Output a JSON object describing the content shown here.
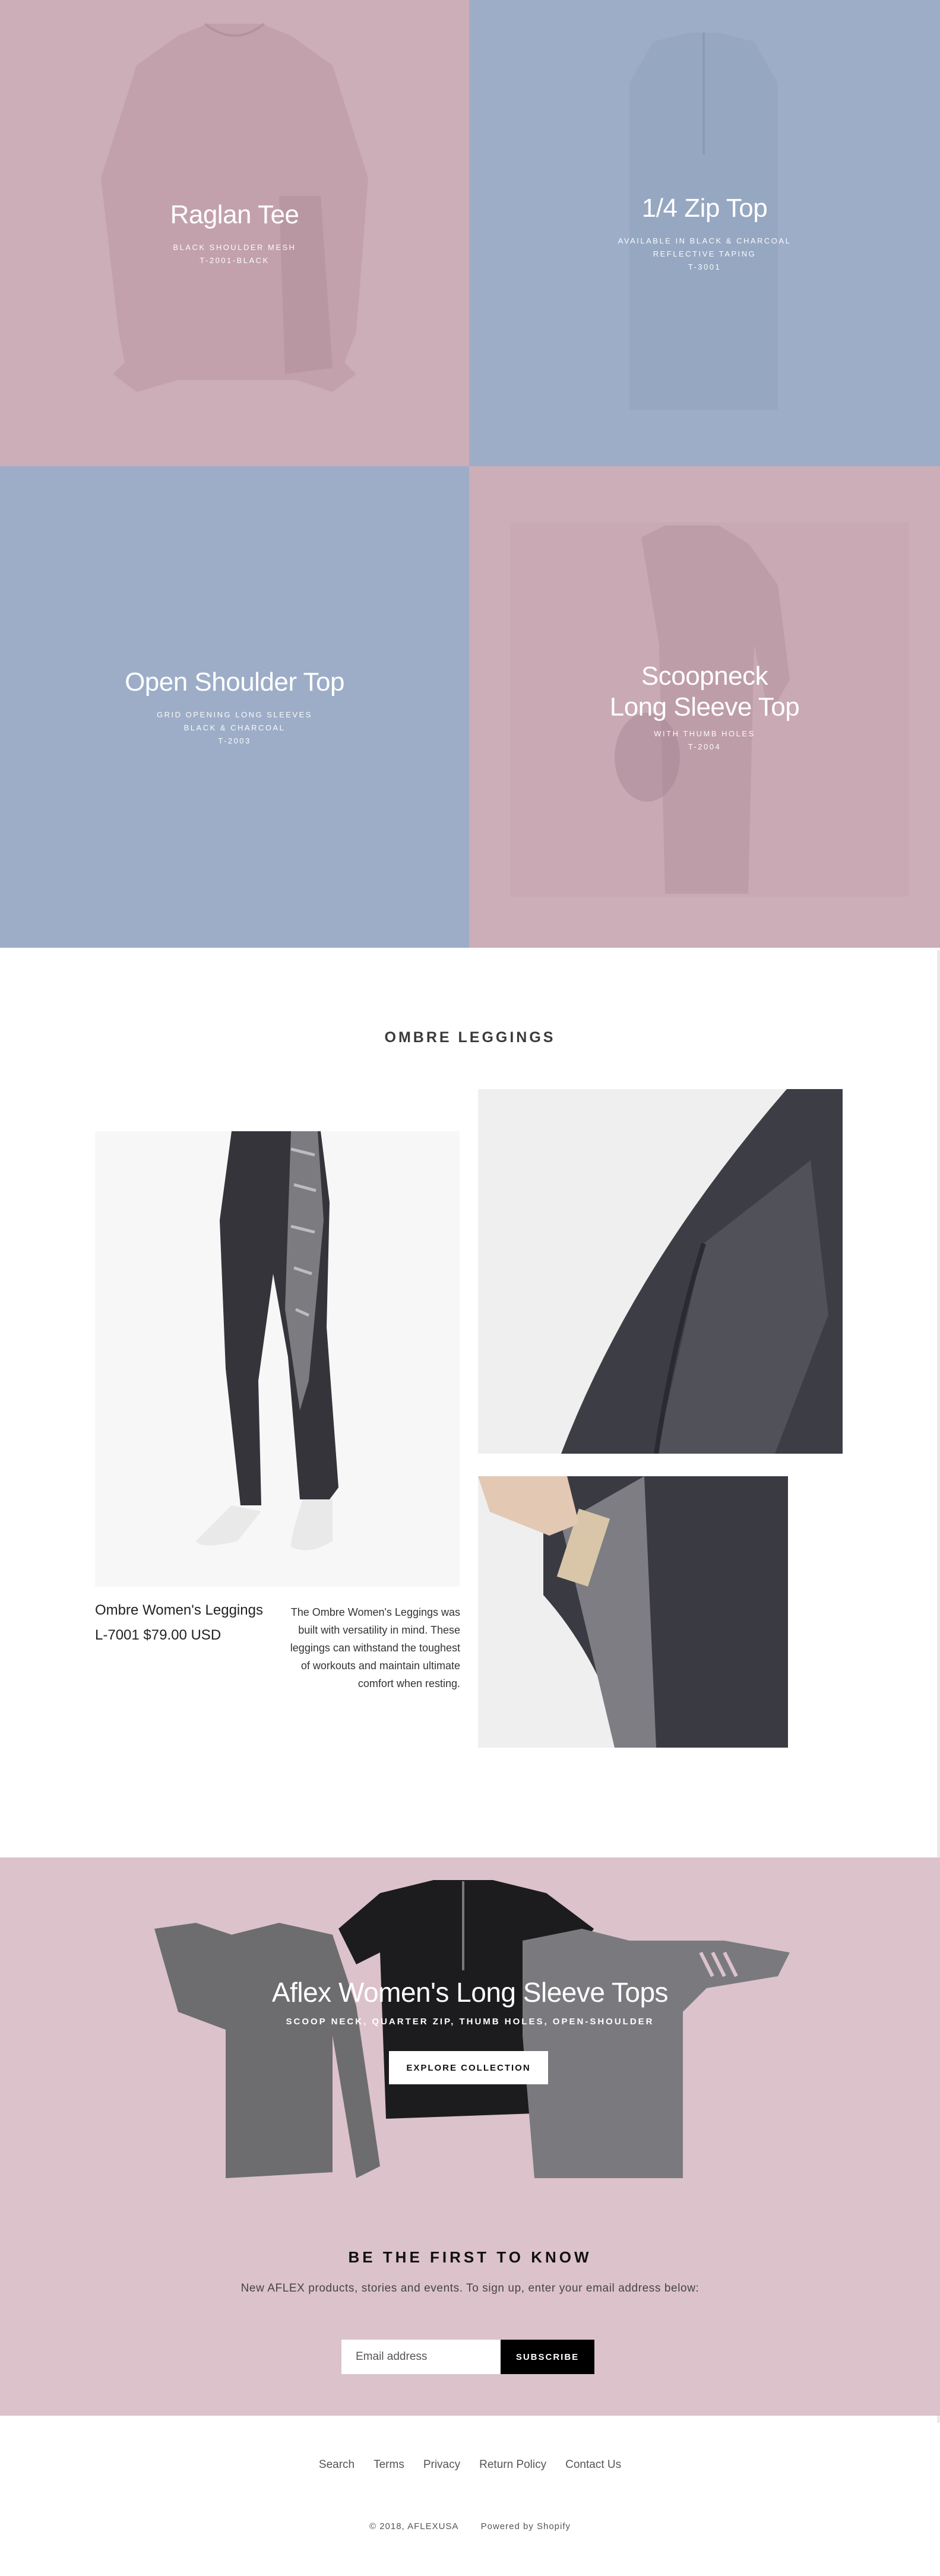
{
  "tiles": [
    {
      "title": "Raglan Tee",
      "lines": [
        "BLACK SHOULDER MESH",
        "T-2001-BLACK"
      ],
      "bg": "#cbaeb8"
    },
    {
      "title": "1/4 Zip Top",
      "lines": [
        "AVAILABLE IN BLACK & CHARCOAL",
        "REFLECTIVE TAPING",
        "T-3001"
      ],
      "bg": "#9dadc7"
    },
    {
      "title": "Open Shoulder Top",
      "lines": [
        "GRID OPENING LONG SLEEVES",
        "BLACK & CHARCOAL",
        "T-2003"
      ],
      "bg": "#9dadc7"
    },
    {
      "title_line1": "Scoopneck",
      "title_line2": "Long Sleeve Top",
      "lines": [
        "WITH THUMB HOLES",
        "T-2004"
      ],
      "bg": "#cbaeb8"
    }
  ],
  "ombre": {
    "section_title": "OMBRE LEGGINGS",
    "product_name": "Ombre Women's Leggings",
    "product_price": "L-7001 $79.00 USD",
    "description": "The Ombre Women's Leggings was built with versatility in mind. These leggings can withstand the toughest of workouts and maintain ultimate comfort when resting."
  },
  "collection": {
    "title": "Aflex Women's Long Sleeve Tops",
    "subtitle": "SCOOP NECK, QUARTER ZIP, THUMB HOLES, OPEN-SHOULDER",
    "button": "EXPLORE COLLECTION"
  },
  "newsletter": {
    "title": "BE THE FIRST TO KNOW",
    "text": "New AFLEX products, stories and events. To sign up, enter your email address below:",
    "placeholder": "Email address",
    "button": "SUBSCRIBE"
  },
  "footer": {
    "links": [
      "Search",
      "Terms",
      "Privacy",
      "Return Policy",
      "Contact Us"
    ],
    "copyright": "© 2018, AFLEXUSA",
    "powered": "Powered by Shopify"
  },
  "colors": {
    "pink": "#cbaeb8",
    "blue": "#9dadc7",
    "hero_pink": "#dcc2cb"
  },
  "icons": {
    "tile_1": "tee-silhouette",
    "tile_2": "zip-top-silhouette",
    "tile_4": "long-sleeve-silhouette"
  }
}
